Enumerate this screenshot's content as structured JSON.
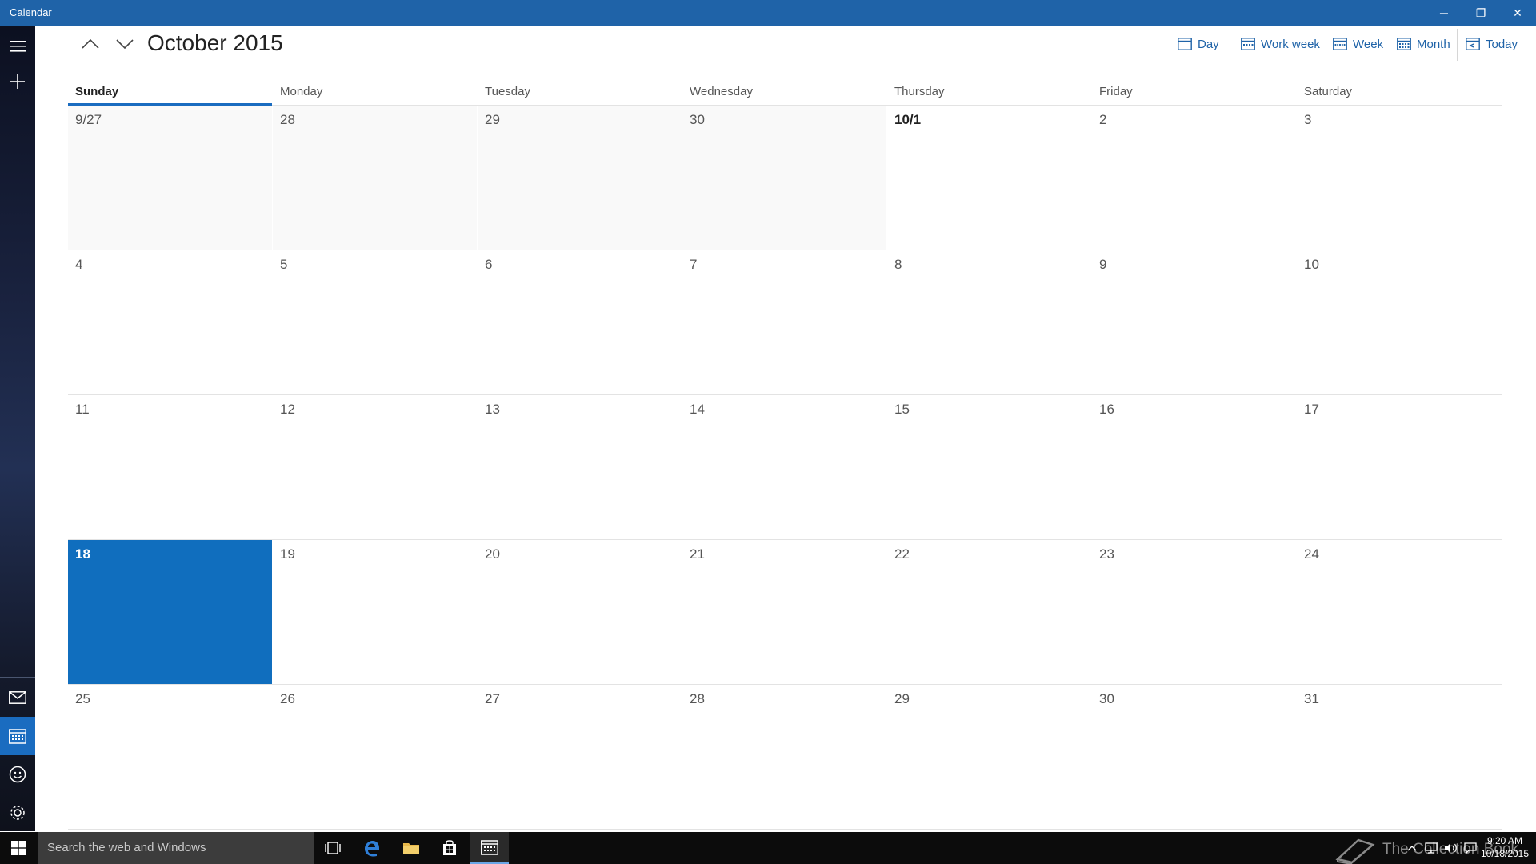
{
  "window": {
    "title": "Calendar",
    "controls": {
      "minimize": "─",
      "maximize": "❐",
      "close": "✕"
    }
  },
  "rail": {
    "icons": [
      "hamburger-menu-icon",
      "plus-icon",
      "mail-icon",
      "calendar-icon",
      "smiley-icon",
      "gear-icon"
    ]
  },
  "header": {
    "month_title": "October 2015",
    "views": {
      "day": "Day",
      "work_week": "Work week",
      "week": "Week",
      "month": "Month",
      "today": "Today"
    }
  },
  "calendar": {
    "weekdays": [
      "Sunday",
      "Monday",
      "Tuesday",
      "Wednesday",
      "Thursday",
      "Friday",
      "Saturday"
    ],
    "current_weekday_index": 0,
    "weeks": [
      [
        "9/27",
        "28",
        "29",
        "30",
        "10/1",
        "2",
        "3"
      ],
      [
        "4",
        "5",
        "6",
        "7",
        "8",
        "9",
        "10"
      ],
      [
        "11",
        "12",
        "13",
        "14",
        "15",
        "16",
        "17"
      ],
      [
        "18",
        "19",
        "20",
        "21",
        "22",
        "23",
        "24"
      ],
      [
        "25",
        "26",
        "27",
        "28",
        "29",
        "30",
        "31"
      ]
    ],
    "other_month_cells": [
      [
        0,
        0
      ],
      [
        0,
        1
      ],
      [
        0,
        2
      ],
      [
        0,
        3
      ]
    ],
    "month_start_cell": [
      0,
      4
    ],
    "today_cell": [
      3,
      0
    ]
  },
  "taskbar": {
    "search_placeholder": "Search the web and Windows",
    "watermark": "The Collection Book",
    "clock_time": "9:20 AM",
    "clock_date": "10/18/2015"
  },
  "colors": {
    "accent": "#106ebe",
    "titlebar": "#1f63a8",
    "link": "#1f63a8"
  }
}
